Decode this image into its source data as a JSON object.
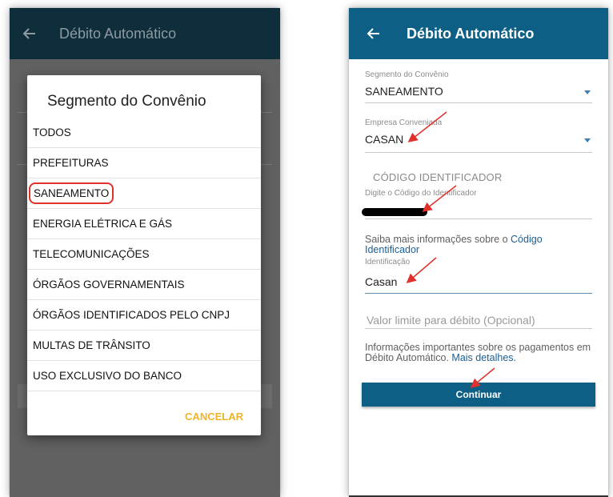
{
  "left": {
    "appbar": {
      "title": "Débito Automático"
    },
    "dialog": {
      "title": "Segmento do Convênio",
      "options": [
        "TODOS",
        "PREFEITURAS",
        "SANEAMENTO",
        "ENERGIA ELÉTRICA E GÁS",
        "TELECOMUNICAÇÕES",
        "ÓRGÃOS GOVERNAMENTAIS",
        "ÓRGÃOS IDENTIFICADOS PELO CNPJ",
        "MULTAS DE TRÂNSITO",
        "USO EXCLUSIVO DO BANCO"
      ],
      "highlighted_option": "SANEAMENTO",
      "cancel_label": "CANCELAR"
    }
  },
  "right": {
    "appbar": {
      "title": "Débito Automático"
    },
    "segment": {
      "label": "Segmento do Convênio",
      "value": "SANEAMENTO"
    },
    "company": {
      "label": "Empresa Conveniada",
      "value": "CASAN"
    },
    "identifier": {
      "section_title": "CÓDIGO IDENTIFICADOR",
      "label": "Digite o Código do Identificador"
    },
    "more_info": {
      "text": "Saiba mais informações sobre o ",
      "link": "Código Identificador"
    },
    "identification": {
      "label": "Identificação",
      "value": "Casan"
    },
    "limit": {
      "placeholder": "Valor limite para débito (Opcional)"
    },
    "important": {
      "text": "Informações importantes sobre os pagamentos em Débito Automático. ",
      "link": "Mais detalhes."
    },
    "continue_label": "Continuar"
  },
  "colors": {
    "highlight_border": "#e0312c",
    "annotation_arrow": "#e0312c",
    "primary_blue": "#0d5f86",
    "cancel_text": "#f0b429"
  }
}
